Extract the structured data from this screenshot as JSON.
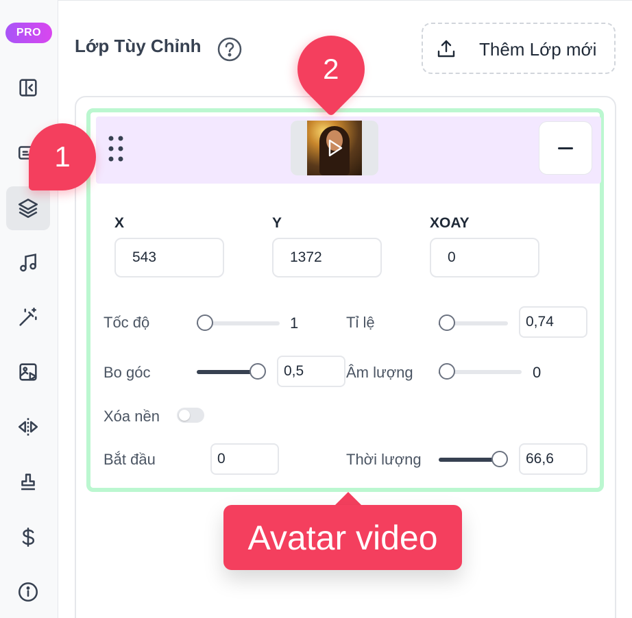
{
  "sidebar": {
    "pro_badge": "PRO",
    "items": [
      {
        "icon": "sidebar-collapse-icon",
        "active": false
      },
      {
        "icon": "subtitles-icon",
        "active": false
      },
      {
        "icon": "layers-icon",
        "active": true
      },
      {
        "icon": "music-note-icon",
        "active": false
      },
      {
        "icon": "magic-wand-icon",
        "active": false
      },
      {
        "icon": "image-video-icon",
        "active": false
      },
      {
        "icon": "flip-icon",
        "active": false
      },
      {
        "icon": "stamp-icon",
        "active": false
      },
      {
        "icon": "dollar-icon",
        "active": false
      },
      {
        "icon": "info-icon",
        "active": false
      }
    ]
  },
  "header": {
    "title": "Lớp Tùy Chỉnh",
    "add_layer_label": "Thêm Lớp mới"
  },
  "layer": {
    "position": {
      "x_label": "X",
      "x_value": "543",
      "y_label": "Y",
      "y_value": "1372",
      "rotate_label": "XOAY",
      "rotate_value": "0"
    },
    "speed": {
      "label": "Tốc độ",
      "value": "1",
      "level": 0.1
    },
    "scale": {
      "label": "Tỉ lệ",
      "value": "0,74",
      "level": 0.03
    },
    "radius": {
      "label": "Bo góc",
      "value": "0,5",
      "level": 1.0
    },
    "volume": {
      "label": "Âm lượng",
      "value": "0",
      "level": 0.0
    },
    "remove_bg": {
      "label": "Xóa nền",
      "enabled": false
    },
    "start": {
      "label": "Bắt đầu",
      "value": "0"
    },
    "duration": {
      "label": "Thời lượng",
      "value": "66,6",
      "level": 1.0
    }
  },
  "callouts": {
    "marker_1": "1",
    "marker_2": "2",
    "tooltip": "Avatar video"
  },
  "colors": {
    "accent": "#f43f5e",
    "pro_gradient_start": "#a855f7",
    "pro_gradient_end": "#d946ef",
    "layer_border": "#bbf7d0",
    "layer_header": "#f3e8ff"
  }
}
